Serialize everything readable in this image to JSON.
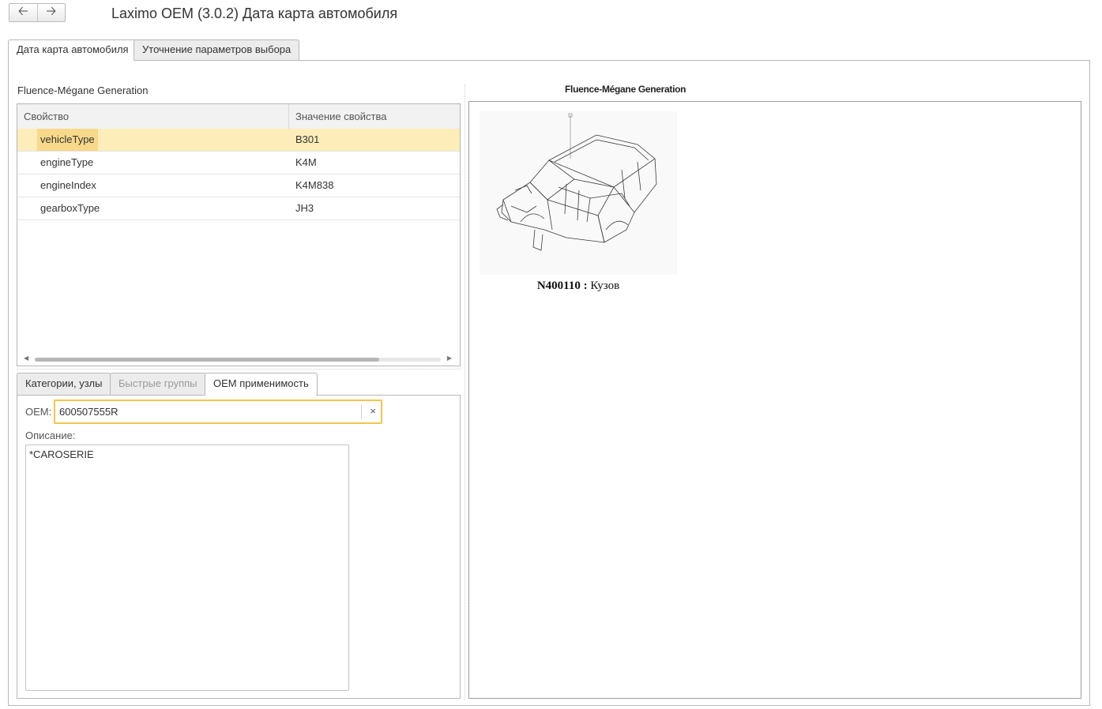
{
  "window": {
    "title": "Laximo OEM (3.0.2) Дата карта автомобиля",
    "back_icon": "arrow-left-icon",
    "forward_icon": "arrow-right-icon"
  },
  "tabs": [
    {
      "label": "Дата карта автомобиля",
      "active": true
    },
    {
      "label": "Уточнение параметров выбора",
      "active": false
    }
  ],
  "left": {
    "title": "Fluence-Mégane Generation",
    "grid": {
      "columns": [
        "Свойство",
        "Значение свойства"
      ],
      "rows": [
        {
          "property": "vehicleType",
          "value": "B301",
          "selected": true
        },
        {
          "property": "engineType",
          "value": "K4M",
          "selected": false
        },
        {
          "property": "engineIndex",
          "value": "K4M838",
          "selected": false
        },
        {
          "property": "gearboxType",
          "value": "JH3",
          "selected": false
        }
      ]
    },
    "subtabs": [
      {
        "label": "Категории, узлы",
        "state": "inactive"
      },
      {
        "label": "Быстрые группы",
        "state": "disabled"
      },
      {
        "label": "OEM применимость",
        "state": "active"
      }
    ],
    "oem": {
      "label": "OEM:",
      "value": "600507555R",
      "clear_icon": "×"
    },
    "description": {
      "label": "Описание:",
      "text": "*CAROSERIE"
    }
  },
  "right": {
    "title": "Fluence-Mégane Generation",
    "unit": {
      "code": "N400110",
      "separator": ":",
      "name": "Кузов",
      "image": "car-body-drawing"
    }
  },
  "colors": {
    "selection_row": "#fcedb9",
    "selection_cell": "#f8d98a",
    "focus_border": "#f2c64b"
  }
}
